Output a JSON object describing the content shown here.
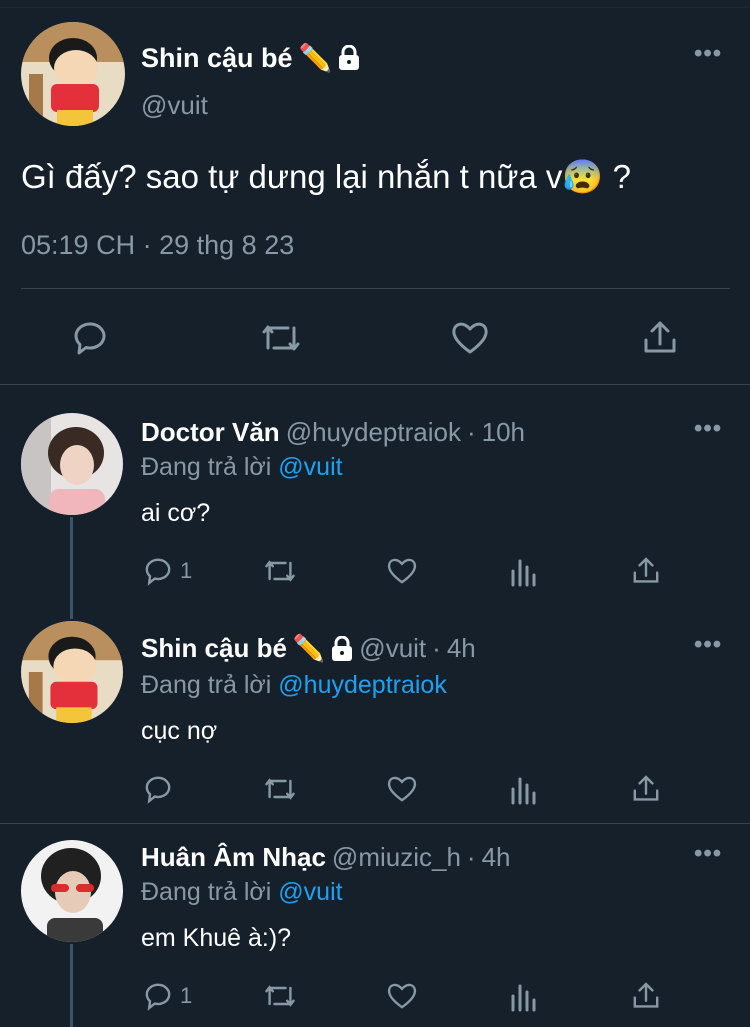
{
  "main_tweet": {
    "display_name": "Shin cậu bé",
    "name_emoji": "✏️",
    "lock_icon": "lock-icon",
    "handle": "@vuit",
    "text": "Gì đấy? sao tự dưng lại nhắn t nữa v😰 ?",
    "time": "05:19 CH",
    "date": "29 thg 8 23",
    "separator": "·",
    "actions": [
      "reply-icon",
      "retweet-icon",
      "like-icon",
      "share-icon"
    ]
  },
  "replies": [
    {
      "display_name": "Doctor Văn",
      "handle": "@huydeptraiok",
      "dot": "·",
      "age": "10h",
      "replying_prefix": "Đang trả lời",
      "replying_to": "@vuit",
      "text": "ai cơ?",
      "reply_count": "1"
    },
    {
      "display_name": "Shin cậu bé",
      "name_emoji": "✏️",
      "handle": "@vuit",
      "dot": "·",
      "age": "4h",
      "replying_prefix": "Đang trả lời",
      "replying_to": "@huydeptraiok",
      "text": "cục nợ",
      "reply_count": ""
    },
    {
      "display_name": "Huân Âm Nhạc",
      "handle": "@miuzic_h",
      "dot": "·",
      "age": "4h",
      "replying_prefix": "Đang trả lời",
      "replying_to": "@vuit",
      "text": "em Khuê à:)?",
      "reply_count": "1"
    }
  ],
  "more_label": "•••",
  "colors": {
    "background": "#15202b",
    "muted": "#8899a6",
    "link": "#1da1f2",
    "divider": "#38444d"
  }
}
